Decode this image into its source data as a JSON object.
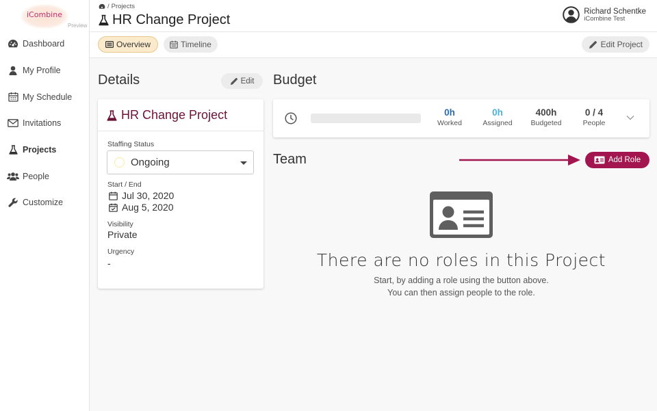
{
  "logo": {
    "text": "iCombine",
    "badge": "Preview"
  },
  "sidebar": {
    "items": [
      {
        "label": "Dashboard",
        "icon": "dashboard-icon"
      },
      {
        "label": "My Profile",
        "icon": "user-icon"
      },
      {
        "label": "My Schedule",
        "icon": "calendar-icon"
      },
      {
        "label": "Invitations",
        "icon": "envelope-icon"
      },
      {
        "label": "Projects",
        "icon": "flask-icon",
        "active": true
      },
      {
        "label": "People",
        "icon": "users-icon"
      },
      {
        "label": "Customize",
        "icon": "wrench-icon"
      }
    ]
  },
  "header": {
    "breadcrumb_sep": "/",
    "breadcrumb": "Projects",
    "title": "HR Change Project",
    "user_name": "Richard Schentke",
    "user_org": "iCombine Test"
  },
  "toolbar": {
    "overview_label": "Overview",
    "timeline_label": "Timeline",
    "edit_project_label": "Edit Project"
  },
  "details": {
    "heading": "Details",
    "edit_label": "Edit",
    "project_name": "HR Change Project",
    "staffing_label": "Staffing Status",
    "staffing_value": "Ongoing",
    "dates_label": "Start / End",
    "start_date": "Jul 30, 2020",
    "end_date": "Aug 5, 2020",
    "visibility_label": "Visibility",
    "visibility_value": "Private",
    "urgency_label": "Urgency",
    "urgency_value": "-"
  },
  "budget": {
    "heading": "Budget",
    "progress": 0,
    "stats": [
      {
        "value": "0h",
        "label": "Worked",
        "color": "#2a6cb0"
      },
      {
        "value": "0h",
        "label": "Assigned",
        "color": "#4cb0d8"
      },
      {
        "value": "400h",
        "label": "Budgeted",
        "color": "#444444"
      },
      {
        "value": "0 / 4",
        "label": "People",
        "color": "#444444"
      }
    ]
  },
  "team": {
    "heading": "Team",
    "add_role_label": "Add Role",
    "empty_title": "There are no roles in this Project",
    "empty_line1": "Start, by adding a role using the button above.",
    "empty_line2": "You can then assign people to the role."
  },
  "colors": {
    "brand": "#a3154f",
    "project_title": "#6b1235",
    "overview_tab": "#fbeacb"
  }
}
